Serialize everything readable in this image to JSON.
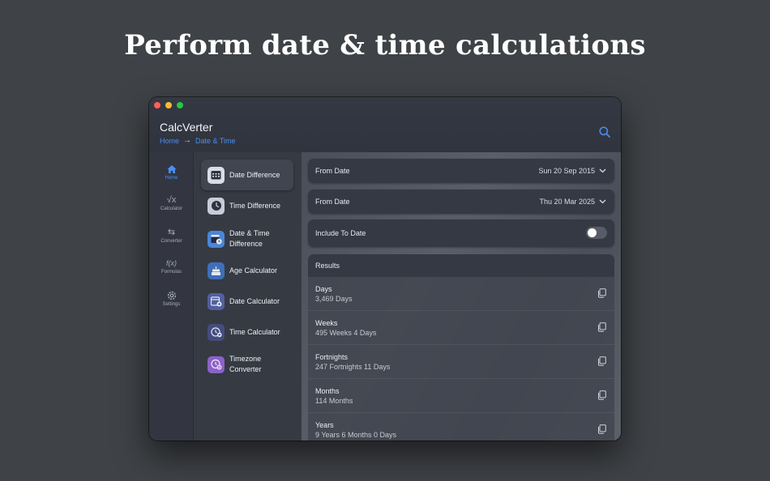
{
  "headline": "Perform date & time calculations",
  "app": {
    "title": "CalcVerter",
    "breadcrumb": {
      "home": "Home",
      "arrow": "→",
      "current": "Date & Time"
    }
  },
  "rail": {
    "items": [
      {
        "label": "Home",
        "icon": "house-icon"
      },
      {
        "label": "Calculator",
        "icon": "sqrt-icon",
        "glyph": "√x"
      },
      {
        "label": "Converter",
        "icon": "swap-arrows-icon",
        "glyph": "⇆"
      },
      {
        "label": "Formulas",
        "icon": "function-icon",
        "glyph": "f(x)"
      },
      {
        "label": "Settings",
        "icon": "gear-icon"
      }
    ]
  },
  "menu": {
    "items": [
      {
        "label": "Date Difference",
        "icon": "calendar-grid-icon"
      },
      {
        "label": "Time Difference",
        "icon": "clock-icon"
      },
      {
        "label": "Date & Time Difference",
        "icon": "calendar-clock-icon"
      },
      {
        "label": "Age Calculator",
        "icon": "cake-icon"
      },
      {
        "label": "Date Calculator",
        "icon": "calendar-plus-icon"
      },
      {
        "label": "Time Calculator",
        "icon": "clock-plus-icon"
      },
      {
        "label": "Timezone Converter",
        "icon": "globe-clock-icon"
      }
    ]
  },
  "form": {
    "from_date_1": {
      "label": "From Date",
      "value": "Sun 20 Sep 2015"
    },
    "from_date_2": {
      "label": "From Date",
      "value": "Thu 20 Mar 2025"
    },
    "include_to_date": {
      "label": "Include To Date",
      "enabled": false
    }
  },
  "results": {
    "header": "Results",
    "rows": [
      {
        "title": "Days",
        "value": "3,469 Days"
      },
      {
        "title": "Weeks",
        "value": "495 Weeks 4 Days"
      },
      {
        "title": "Fortnights",
        "value": "247 Fortnights 11 Days"
      },
      {
        "title": "Months",
        "value": "114 Months"
      },
      {
        "title": "Years",
        "value": "9 Years 6 Months 0 Days"
      }
    ]
  },
  "colors": {
    "accent": "#4b8ff0",
    "traffic_close": "#ff5f57",
    "traffic_minimize": "#febc2e",
    "traffic_maximize": "#28c840"
  }
}
